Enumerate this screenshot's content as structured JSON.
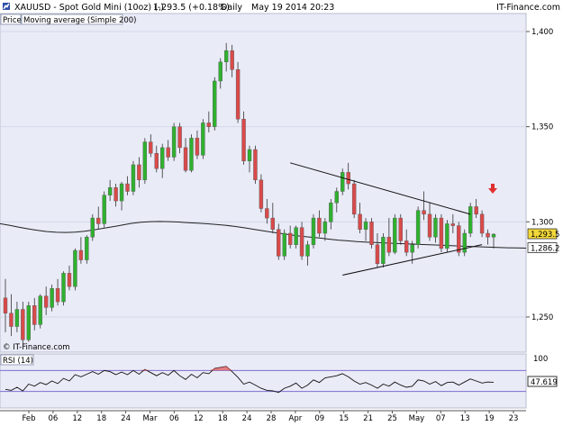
{
  "header": {
    "symbol": "XAUUSD - Spot Gold Mini (10oz) (-)",
    "last": "1,293.5 (+0.18%)",
    "interval": "Daily",
    "datetime": "May 19 2014 20:23",
    "brand": "IT-Finance.com"
  },
  "legend": {
    "panel": "Price",
    "indicator": "Moving average (Simple 200)"
  },
  "watermark": "© IT-Finance.com",
  "rsi_panel": {
    "label": "RSI (14)",
    "value": "47.619"
  },
  "colors": {
    "up": "#2fb12f",
    "down": "#d94a4a",
    "background": "#e9ebf7",
    "ma": "#222222",
    "trendline": "#111111",
    "rsi_band": "#7b6fd0",
    "arrow": "#e03030",
    "last_price_tag": "#f3d83a"
  },
  "chart_data": {
    "type": "candlestick",
    "title": "XAUUSD - Spot Gold Mini (10oz) (-)",
    "y_ticks": [
      "1,250",
      "1,300",
      "1,350",
      "1,400"
    ],
    "y_tick_values": [
      1250,
      1300,
      1350,
      1400
    ],
    "ylim": [
      1232,
      1409
    ],
    "x_ticks": [
      "Feb",
      "06",
      "12",
      "18",
      "24",
      "Mar",
      "06",
      "12",
      "18",
      "24",
      "28",
      "Apr",
      "09",
      "15",
      "21",
      "25",
      "May",
      "07",
      "13",
      "19",
      "23"
    ],
    "price_tags": [
      {
        "label": "1,293.5",
        "value": 1293.5
      },
      {
        "label": "1,286.2",
        "value": 1286.2
      }
    ],
    "candles": [
      [
        1260,
        1270,
        1242,
        1252
      ],
      [
        1252,
        1262,
        1240,
        1245
      ],
      [
        1245,
        1258,
        1242,
        1254
      ],
      [
        1254,
        1258,
        1236,
        1238
      ],
      [
        1238,
        1258,
        1237,
        1256
      ],
      [
        1256,
        1260,
        1243,
        1246
      ],
      [
        1246,
        1262,
        1244,
        1261
      ],
      [
        1261,
        1266,
        1251,
        1255
      ],
      [
        1255,
        1267,
        1253,
        1265
      ],
      [
        1265,
        1270,
        1256,
        1258
      ],
      [
        1258,
        1274,
        1256,
        1273
      ],
      [
        1273,
        1277,
        1264,
        1266
      ],
      [
        1266,
        1286,
        1264,
        1285
      ],
      [
        1285,
        1292,
        1278,
        1280
      ],
      [
        1280,
        1293,
        1278,
        1292
      ],
      [
        1292,
        1304,
        1290,
        1302
      ],
      [
        1302,
        1308,
        1296,
        1299
      ],
      [
        1299,
        1316,
        1297,
        1314
      ],
      [
        1314,
        1322,
        1311,
        1318
      ],
      [
        1318,
        1320,
        1308,
        1311
      ],
      [
        1311,
        1321,
        1306,
        1320
      ],
      [
        1320,
        1324,
        1314,
        1316
      ],
      [
        1316,
        1332,
        1314,
        1330
      ],
      [
        1330,
        1334,
        1318,
        1322
      ],
      [
        1322,
        1344,
        1320,
        1342
      ],
      [
        1342,
        1346,
        1334,
        1336
      ],
      [
        1336,
        1340,
        1326,
        1328
      ],
      [
        1328,
        1341,
        1323,
        1339
      ],
      [
        1339,
        1343,
        1332,
        1334
      ],
      [
        1334,
        1352,
        1332,
        1350
      ],
      [
        1350,
        1352,
        1336,
        1339
      ],
      [
        1339,
        1344,
        1326,
        1327
      ],
      [
        1327,
        1346,
        1326,
        1344
      ],
      [
        1344,
        1348,
        1333,
        1335
      ],
      [
        1335,
        1354,
        1333,
        1352
      ],
      [
        1352,
        1358,
        1347,
        1350
      ],
      [
        1350,
        1376,
        1348,
        1374
      ],
      [
        1374,
        1386,
        1370,
        1384
      ],
      [
        1384,
        1394,
        1379,
        1390
      ],
      [
        1390,
        1393,
        1376,
        1380
      ],
      [
        1380,
        1384,
        1352,
        1354
      ],
      [
        1354,
        1358,
        1330,
        1332
      ],
      [
        1332,
        1340,
        1326,
        1338
      ],
      [
        1338,
        1340,
        1320,
        1322
      ],
      [
        1322,
        1325,
        1305,
        1307
      ],
      [
        1307,
        1312,
        1299,
        1302
      ],
      [
        1302,
        1310,
        1294,
        1296
      ],
      [
        1296,
        1299,
        1280,
        1282
      ],
      [
        1282,
        1296,
        1280,
        1294
      ],
      [
        1294,
        1298,
        1286,
        1288
      ],
      [
        1288,
        1298,
        1286,
        1297
      ],
      [
        1297,
        1300,
        1280,
        1282
      ],
      [
        1282,
        1290,
        1277,
        1288
      ],
      [
        1288,
        1304,
        1286,
        1302
      ],
      [
        1302,
        1306,
        1292,
        1294
      ],
      [
        1294,
        1302,
        1290,
        1300
      ],
      [
        1300,
        1312,
        1296,
        1310
      ],
      [
        1310,
        1318,
        1305,
        1316
      ],
      [
        1316,
        1328,
        1314,
        1326
      ],
      [
        1326,
        1331,
        1317,
        1320
      ],
      [
        1320,
        1322,
        1302,
        1304
      ],
      [
        1304,
        1310,
        1294,
        1296
      ],
      [
        1296,
        1302,
        1290,
        1300
      ],
      [
        1300,
        1302,
        1286,
        1288
      ],
      [
        1288,
        1294,
        1276,
        1278
      ],
      [
        1278,
        1294,
        1276,
        1292
      ],
      [
        1292,
        1302,
        1282,
        1284
      ],
      [
        1284,
        1304,
        1283,
        1302
      ],
      [
        1302,
        1304,
        1288,
        1290
      ],
      [
        1290,
        1296,
        1282,
        1284
      ],
      [
        1284,
        1290,
        1278,
        1288
      ],
      [
        1288,
        1308,
        1286,
        1306
      ],
      [
        1306,
        1316,
        1301,
        1304
      ],
      [
        1304,
        1310,
        1290,
        1292
      ],
      [
        1292,
        1304,
        1289,
        1302
      ],
      [
        1302,
        1304,
        1284,
        1286
      ],
      [
        1286,
        1301,
        1284,
        1299
      ],
      [
        1299,
        1304,
        1294,
        1298
      ],
      [
        1298,
        1300,
        1282,
        1284
      ],
      [
        1284,
        1296,
        1282,
        1294
      ],
      [
        1294,
        1310,
        1292,
        1308
      ],
      [
        1308,
        1312,
        1302,
        1304
      ],
      [
        1304,
        1306,
        1292,
        1294
      ],
      [
        1294,
        1296,
        1288,
        1292
      ],
      [
        1292,
        1294,
        1286,
        1293.5
      ]
    ],
    "ma200": [
      1299,
      1298.2,
      1297.2,
      1296.3,
      1295.5,
      1294.9,
      1294.5,
      1294.4,
      1294.6,
      1295.1,
      1295.8,
      1296.6,
      1297.4,
      1298.3,
      1299.2,
      1299.8,
      1300.1,
      1300.2,
      1300.1,
      1299.9,
      1299.6,
      1299.3,
      1299,
      1298.6,
      1298.2,
      1297.6,
      1296.9,
      1296.1,
      1295.3,
      1294.5,
      1293.8,
      1293.1,
      1292.5,
      1292,
      1291.5,
      1290.9,
      1290.4,
      1290,
      1289.6,
      1289.3,
      1289.1,
      1288.9,
      1288.7,
      1288.5,
      1288.3,
      1288.1,
      1287.9,
      1287.7,
      1287.5,
      1287.3,
      1287.1,
      1286.9,
      1286.7,
      1286.5,
      1286.4,
      1286.3,
      1286.2
    ],
    "trendlines": [
      {
        "from": [
          49,
          1331
        ],
        "to": [
          80,
          1304
        ]
      },
      {
        "from": [
          58,
          1272
        ],
        "to": [
          82,
          1288
        ]
      }
    ],
    "rsi": {
      "ylim": [
        0,
        100
      ],
      "levels": [
        30,
        70
      ],
      "tick": "100",
      "values": [
        34,
        32,
        38,
        31,
        44,
        40,
        47,
        43,
        50,
        45,
        55,
        50,
        62,
        58,
        63,
        68,
        63,
        70,
        68,
        62,
        67,
        62,
        70,
        63,
        72,
        66,
        60,
        66,
        61,
        70,
        60,
        53,
        63,
        56,
        66,
        64,
        74,
        76,
        78,
        68,
        57,
        44,
        48,
        42,
        36,
        32,
        31,
        28,
        36,
        40,
        46,
        36,
        42,
        52,
        47,
        56,
        58,
        60,
        64,
        58,
        50,
        44,
        47,
        42,
        36,
        44,
        40,
        48,
        42,
        38,
        40,
        52,
        50,
        44,
        49,
        41,
        47,
        48,
        42,
        48,
        54,
        50,
        46,
        48,
        47.6
      ]
    }
  }
}
